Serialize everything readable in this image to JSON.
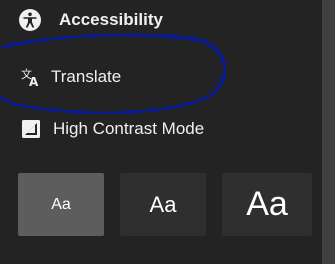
{
  "menu": {
    "accessibility": {
      "label": "Accessibility",
      "icon": "accessibility-icon"
    },
    "translate": {
      "label": "Translate",
      "icon": "translate-icon"
    },
    "high_contrast": {
      "label": "High Contrast Mode",
      "icon": "contrast-icon"
    }
  },
  "text_size": {
    "small": "Aa",
    "medium": "Aa",
    "large": "Aa",
    "selected": "small"
  },
  "colors": {
    "panel_bg": "#232323",
    "selected_bg": "#5d5d5d",
    "button_bg": "#2f2f2f",
    "text": "#f0f0f0",
    "annotation": "#0b1c8c"
  }
}
